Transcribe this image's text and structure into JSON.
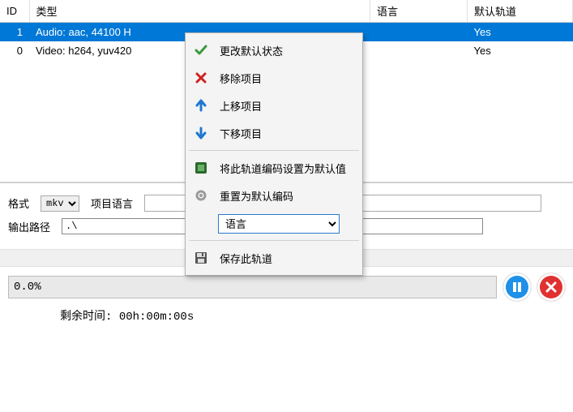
{
  "columns": {
    "id": "ID",
    "type": "类型",
    "lang": "语言",
    "default": "默认轨道"
  },
  "rows": [
    {
      "id": "1",
      "type": "Audio: aac, 44100 H",
      "lang": "",
      "default": "Yes",
      "selected": true
    },
    {
      "id": "0",
      "type": "Video: h264, yuv420",
      "lang": "",
      "default": "Yes",
      "selected": false
    }
  ],
  "form": {
    "format_label": "格式",
    "format_value": "mkv",
    "item_lang_label": "项目语言",
    "item_lang_value": "",
    "output_path_label": "输出路径",
    "output_path_value": ".\\"
  },
  "context_menu": {
    "change_default": "更改默认状态",
    "remove": "移除项目",
    "move_up": "上移项目",
    "move_down": "下移项目",
    "set_encoding_default": "将此轨道编码设置为默认值",
    "reset_encoding": "重置为默认编码",
    "language_combo": "语言",
    "save_track": "保存此轨道"
  },
  "progress": {
    "percent_text": "0.0%",
    "remaining_label": "剩余时间: ",
    "remaining_value": "00h:00m:00s"
  },
  "icons": {
    "check": "check-icon",
    "x": "x-icon",
    "up": "arrow-up-icon",
    "down": "arrow-down-icon",
    "square": "encoding-icon",
    "gear": "gear-icon",
    "save": "floppy-icon",
    "pause": "pause-icon",
    "cancel": "cancel-icon"
  }
}
